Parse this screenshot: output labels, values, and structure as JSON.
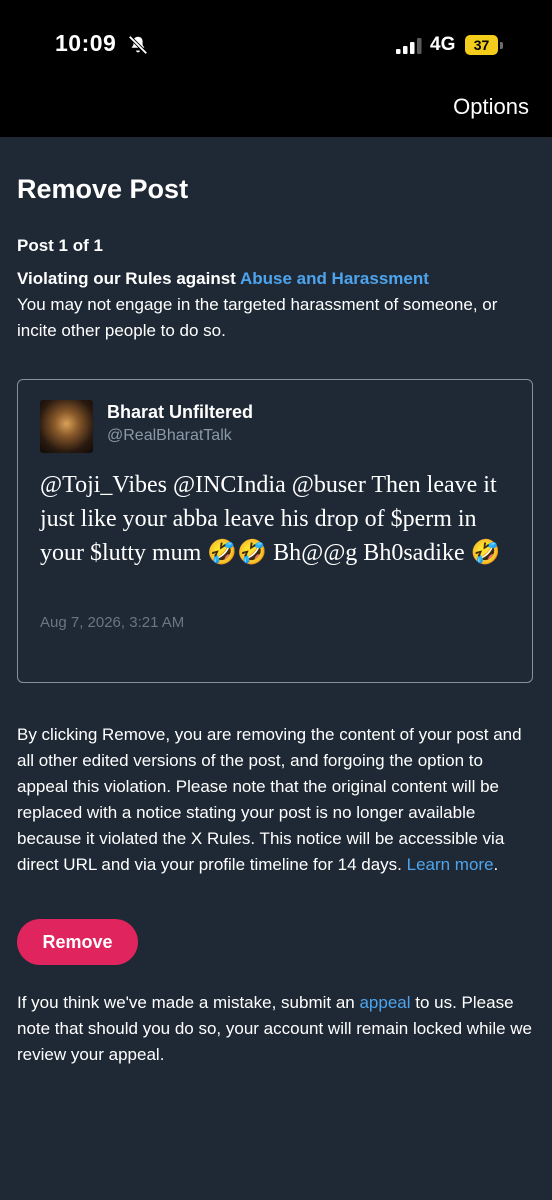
{
  "status_bar": {
    "time": "10:09",
    "network": "4G",
    "battery": "37",
    "icons": [
      "bell-off-icon",
      "signal-icon",
      "battery-icon"
    ]
  },
  "header": {
    "options_label": "Options"
  },
  "page": {
    "title": "Remove Post",
    "post_count": "Post 1 of 1",
    "violation_lead": "Violating our Rules against ",
    "violation_link": "Abuse and Harassment",
    "violation_desc": "You may not engage in the targeted harassment of someone, or incite other people to do so."
  },
  "post": {
    "author_name": "Bharat Unfiltered",
    "author_handle": "@RealBharatTalk",
    "text": "@Toji_Vibes @INCIndia @buser Then leave it just like your abba leave his drop of $perm in your $lutty mum 🤣🤣 Bh@@g Bh0sadike 🤣",
    "date": "Aug 7, 2026, 3:21 AM"
  },
  "disclaimer": {
    "text": "By clicking Remove, you are removing the content of your post and all other edited versions of the post, and forgoing the option to appeal this violation. Please note that the original content will be replaced with a notice stating your post is no longer available because it violated the X Rules. This notice will be accessible via direct URL and via your profile timeline for 14 days. ",
    "learn_more": "Learn more",
    "end": "."
  },
  "actions": {
    "remove_label": "Remove"
  },
  "appeal": {
    "before": "If you think we've made a mistake, submit an ",
    "link": "appeal",
    "after": " to us. Please note that should you do so, your account will remain locked while we review your appeal."
  },
  "colors": {
    "background": "#1f2935",
    "link": "#4ea4ec",
    "remove_button": "#e0245e",
    "battery": "#f4cd1c"
  }
}
